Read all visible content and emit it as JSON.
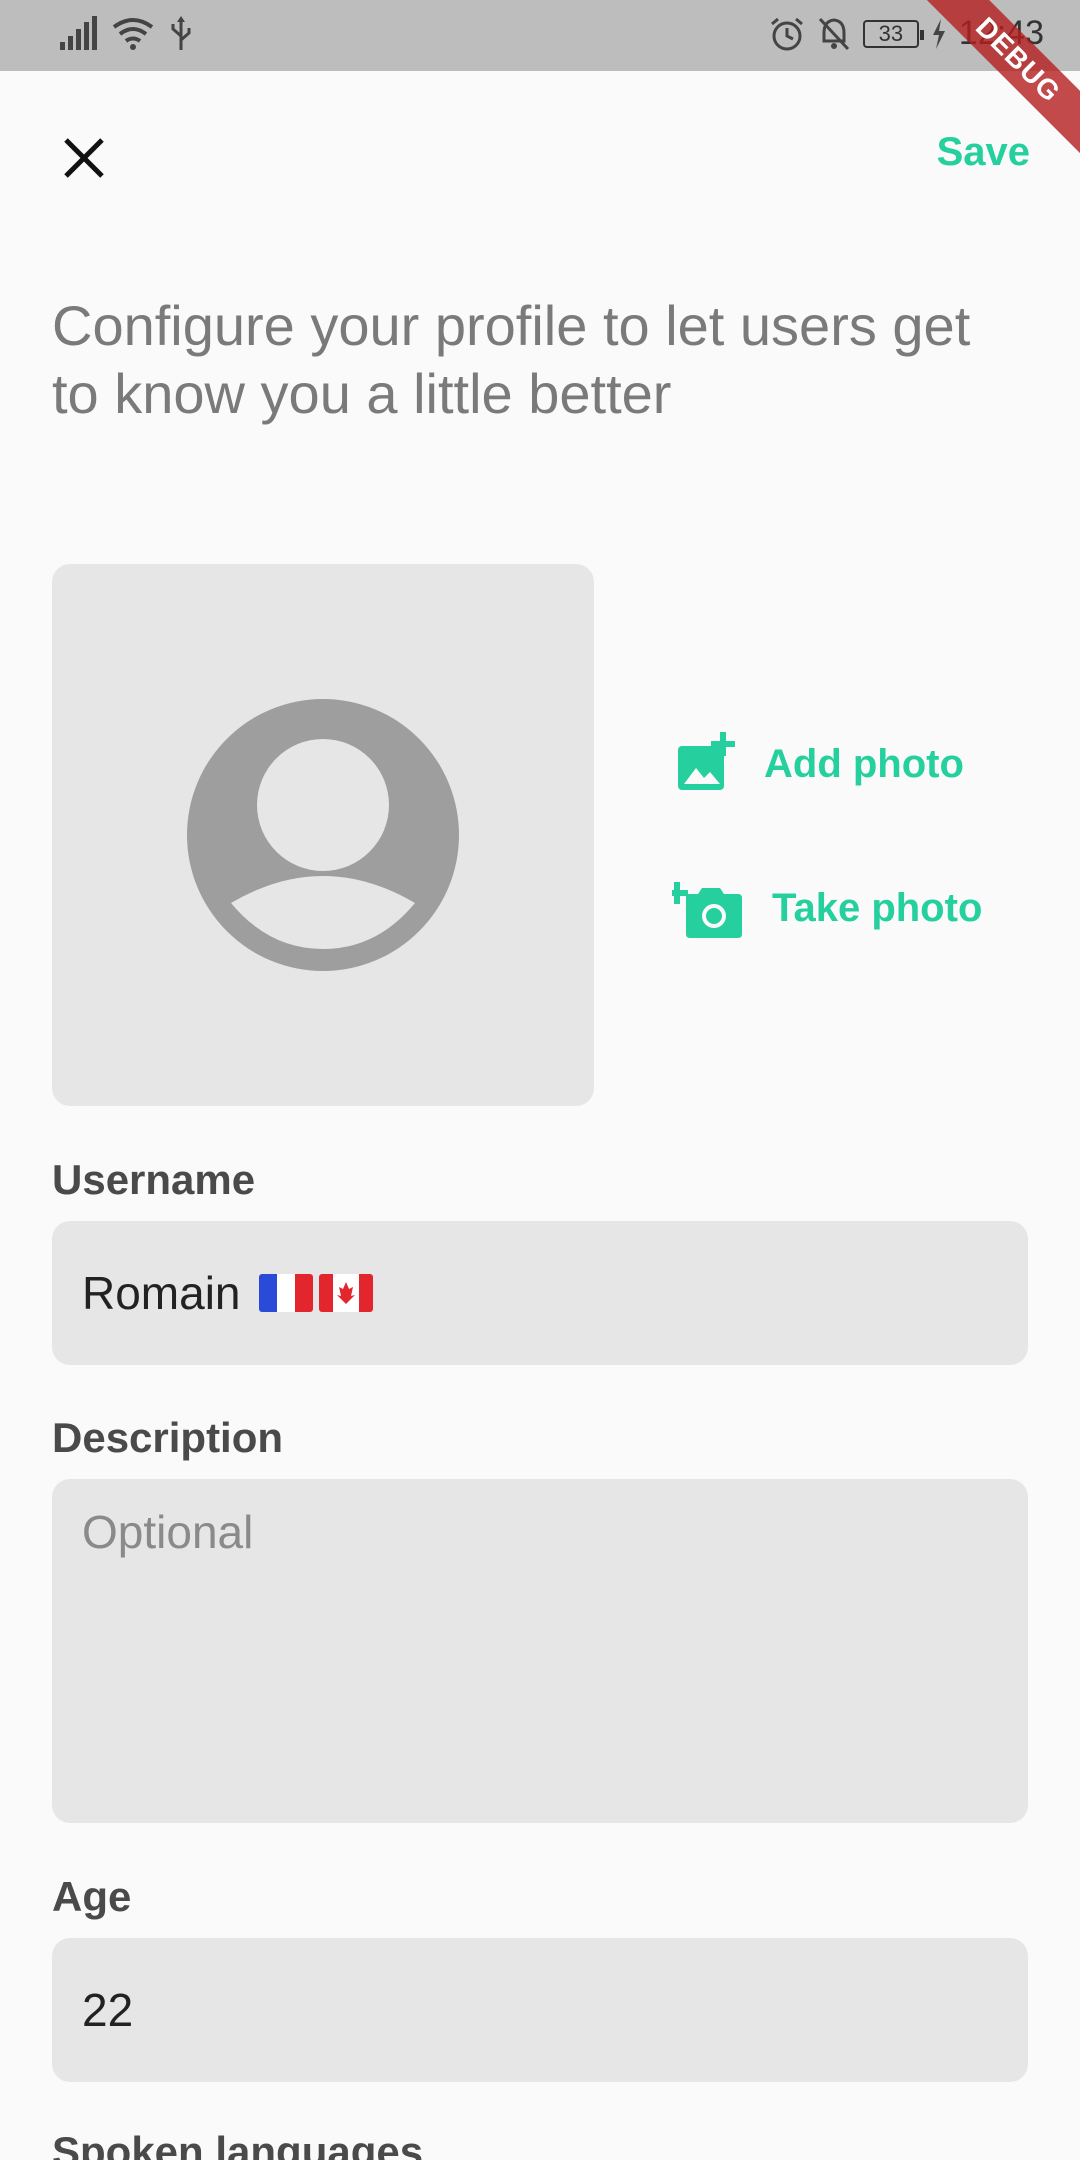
{
  "status_bar": {
    "time": "12:43",
    "battery": "33"
  },
  "debug_label": "DEBUG",
  "header": {
    "save_label": "Save"
  },
  "intro_text": "Configure your profile to let users get to know you a little better",
  "photo": {
    "add_label": "Add photo",
    "take_label": "Take photo"
  },
  "fields": {
    "username": {
      "label": "Username",
      "value": "Romain"
    },
    "description": {
      "label": "Description",
      "placeholder": "Optional"
    },
    "age": {
      "label": "Age",
      "value": "22"
    },
    "spoken_languages": {
      "label": "Spoken languages"
    }
  },
  "colors": {
    "accent": "#26d09e",
    "field_bg": "#e6e6e6",
    "status_bar": "#bdbdbd"
  }
}
